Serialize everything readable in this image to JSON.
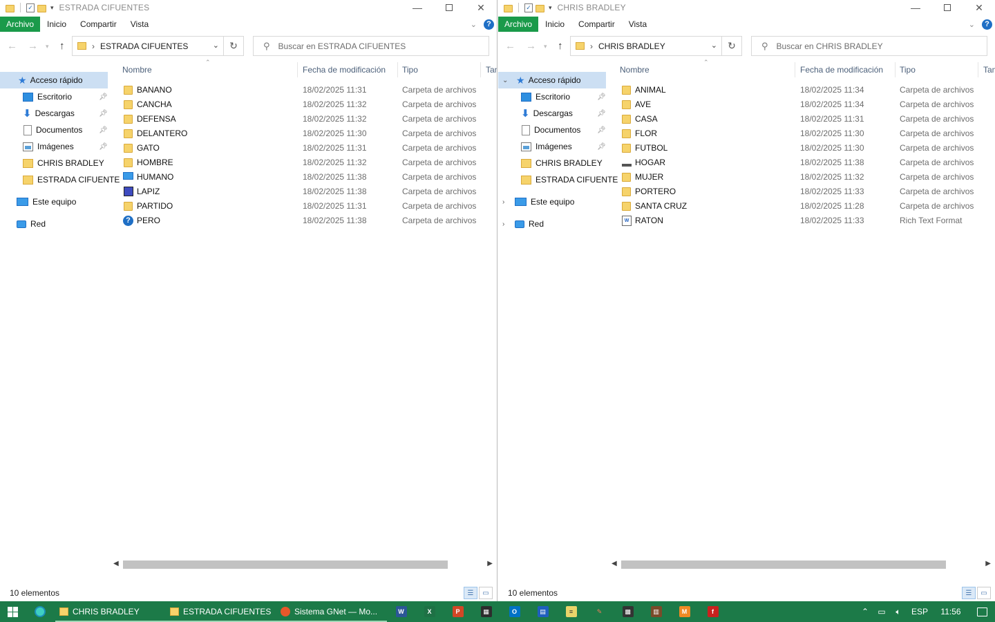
{
  "windows": [
    {
      "title": "ESTRADA CIFUENTES",
      "ribbon_tabs": [
        "Archivo",
        "Inicio",
        "Compartir",
        "Vista"
      ],
      "address": "ESTRADA CIFUENTES",
      "search_placeholder": "Buscar en ESTRADA CIFUENTES",
      "nav": {
        "quick_access": "Acceso rápido",
        "items": [
          "Escritorio",
          "Descargas",
          "Documentos",
          "Imágenes",
          "CHRIS BRADLEY",
          "ESTRADA CIFUENTE"
        ],
        "this_pc": "Este equipo",
        "network": "Red"
      },
      "columns": {
        "name": "Nombre",
        "date": "Fecha de modificación",
        "type": "Tipo",
        "size": "Tam"
      },
      "files": [
        {
          "name": "BANANO",
          "date": "18/02/2025 11:31",
          "type": "Carpeta de archivos",
          "icon": "folder-icon"
        },
        {
          "name": "CANCHA",
          "date": "18/02/2025 11:32",
          "type": "Carpeta de archivos",
          "icon": "folder-icon"
        },
        {
          "name": "DEFENSA",
          "date": "18/02/2025 11:32",
          "type": "Carpeta de archivos",
          "icon": "folder-icon"
        },
        {
          "name": "DELANTERO",
          "date": "18/02/2025 11:30",
          "type": "Carpeta de archivos",
          "icon": "folder-icon"
        },
        {
          "name": "GATO",
          "date": "18/02/2025 11:31",
          "type": "Carpeta de archivos",
          "icon": "folder-icon"
        },
        {
          "name": "HOMBRE",
          "date": "18/02/2025 11:32",
          "type": "Carpeta de archivos",
          "icon": "folder-icon"
        },
        {
          "name": "HUMANO",
          "date": "18/02/2025 11:38",
          "type": "Carpeta de archivos",
          "icon": "monitor-icon"
        },
        {
          "name": "LAPIZ",
          "date": "18/02/2025 11:38",
          "type": "Carpeta de archivos",
          "icon": "image-icon"
        },
        {
          "name": "PARTIDO",
          "date": "18/02/2025 11:31",
          "type": "Carpeta de archivos",
          "icon": "folder-icon"
        },
        {
          "name": "PERO",
          "date": "18/02/2025 11:38",
          "type": "Carpeta de archivos",
          "icon": "help-icon"
        }
      ],
      "status": "10 elementos"
    },
    {
      "title": "CHRIS BRADLEY",
      "ribbon_tabs": [
        "Archivo",
        "Inicio",
        "Compartir",
        "Vista"
      ],
      "address": "CHRIS BRADLEY",
      "search_placeholder": "Buscar en CHRIS BRADLEY",
      "nav": {
        "quick_access": "Acceso rápido",
        "items": [
          "Escritorio",
          "Descargas",
          "Documentos",
          "Imágenes",
          "CHRIS BRADLEY",
          "ESTRADA CIFUENTE"
        ],
        "this_pc": "Este equipo",
        "network": "Red"
      },
      "columns": {
        "name": "Nombre",
        "date": "Fecha de modificación",
        "type": "Tipo",
        "size": "Tam"
      },
      "files": [
        {
          "name": "ANIMAL",
          "date": "18/02/2025 11:34",
          "type": "Carpeta de archivos",
          "icon": "folder-icon"
        },
        {
          "name": "AVE",
          "date": "18/02/2025 11:34",
          "type": "Carpeta de archivos",
          "icon": "folder-icon"
        },
        {
          "name": "CASA",
          "date": "18/02/2025 11:31",
          "type": "Carpeta de archivos",
          "icon": "folder-icon"
        },
        {
          "name": "FLOR",
          "date": "18/02/2025 11:30",
          "type": "Carpeta de archivos",
          "icon": "folder-icon"
        },
        {
          "name": "FUTBOL",
          "date": "18/02/2025 11:30",
          "type": "Carpeta de archivos",
          "icon": "folder-icon"
        },
        {
          "name": "HOGAR",
          "date": "18/02/2025 11:38",
          "type": "Carpeta de archivos",
          "icon": "drive-icon"
        },
        {
          "name": "MUJER",
          "date": "18/02/2025 11:32",
          "type": "Carpeta de archivos",
          "icon": "folder-icon"
        },
        {
          "name": "PORTERO",
          "date": "18/02/2025 11:33",
          "type": "Carpeta de archivos",
          "icon": "folder-icon"
        },
        {
          "name": "SANTA CRUZ",
          "date": "18/02/2025 11:28",
          "type": "Carpeta de archivos",
          "icon": "folder-icon"
        },
        {
          "name": "RATON",
          "date": "18/02/2025 11:33",
          "type": "Rich Text Format",
          "icon": "document-icon"
        }
      ],
      "status": "10 elementos"
    }
  ],
  "taskbar": {
    "tasks": [
      "CHRIS BRADLEY",
      "ESTRADA CIFUENTES",
      "Sistema GNet — Mo..."
    ],
    "language": "ESP",
    "clock": "11:56"
  },
  "colors": {
    "accent": "#1a9a4a",
    "taskbar": "#1c7a48",
    "selection": "#ccdff3"
  }
}
